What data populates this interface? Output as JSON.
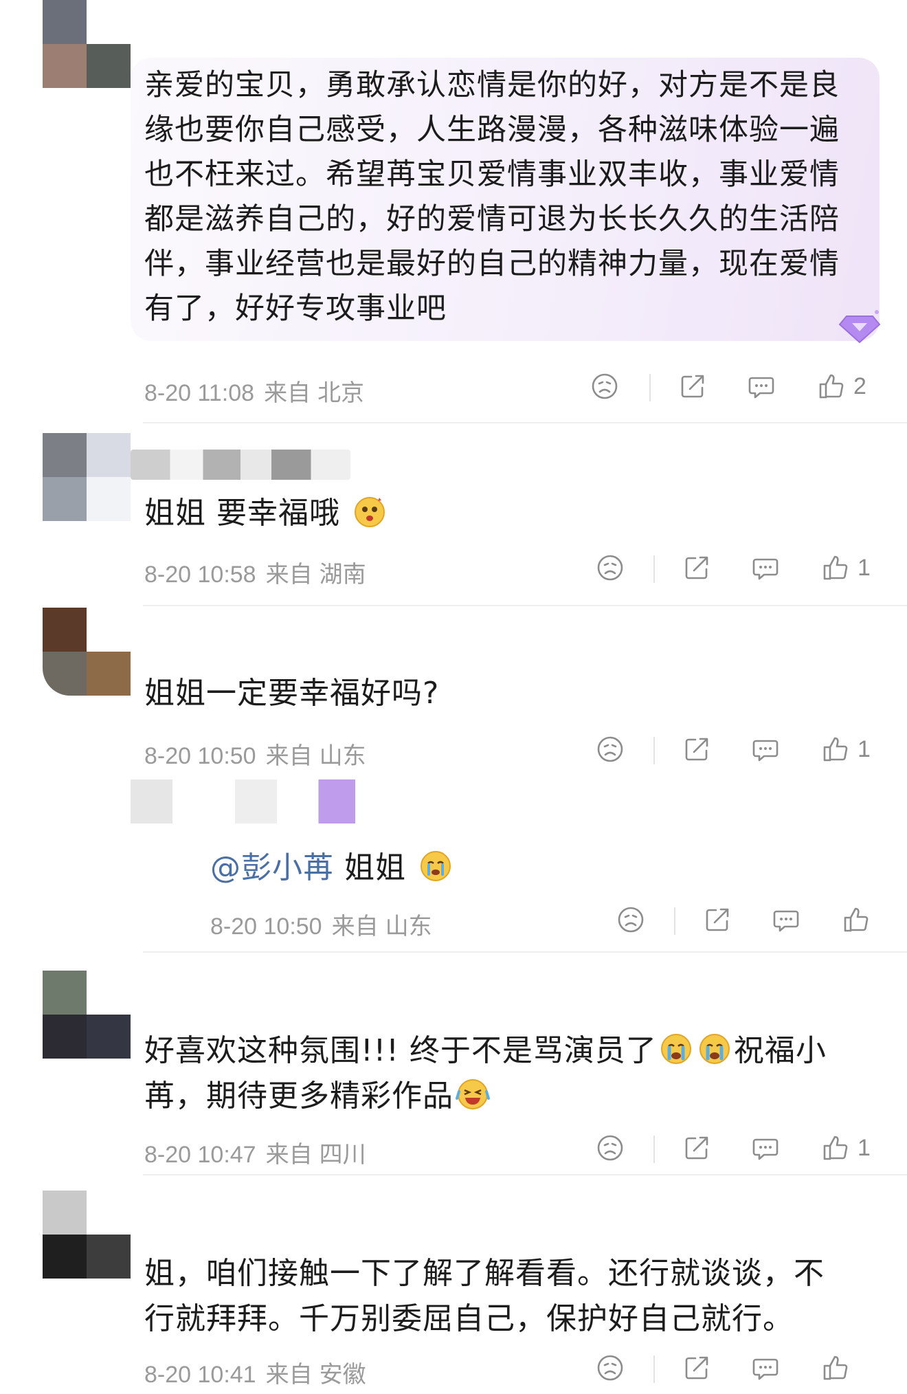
{
  "comments": [
    {
      "text": "亲爱的宝贝，勇敢承认恋情是你的好，对方是不是良缘也要你自己感受，人生路漫漫，各种滋味体验一遍也不枉来过。希望苒宝贝爱情事业双丰收，事业爱情都是滋养自己的，好的爱情可退为长长久久的生活陪伴，事业经营也是最好的自己的精神力量，现在爱情有了，好好专攻事业吧",
      "date": "8-20 11:08",
      "source_label": "来自",
      "location": "北京",
      "likes": "2"
    },
    {
      "text": "姐姐 要幸福哦",
      "date": "8-20 10:58",
      "source_label": "来自",
      "location": "湖南",
      "likes": "1"
    },
    {
      "text": "姐姐一定要幸福好吗?",
      "date": "8-20 10:50",
      "source_label": "来自",
      "location": "山东",
      "likes": "1",
      "reply": {
        "mention": "@彭小苒",
        "text": "姐姐",
        "date": "8-20 10:50",
        "source_label": "来自",
        "location": "山东"
      }
    },
    {
      "text_part1": "好喜欢这种氛围!!! 终于不是骂演员了",
      "text_part2": "祝福小苒，期待更多精彩作品",
      "date": "8-20 10:47",
      "source_label": "来自",
      "location": "四川",
      "likes": "1"
    },
    {
      "text": "姐，咱们接触一下了解了解看看。还行就谈谈，不行就拜拜。千万别委屈自己，保护好自己就行。",
      "date": "8-20 10:41",
      "source_label": "来自",
      "location": "安徽"
    }
  ],
  "icons": {
    "dislike": "frown-face-icon",
    "share": "share-icon",
    "comment": "comment-icon",
    "like": "thumbs-up-icon",
    "badge": "diamond-badge-icon"
  },
  "colors": {
    "meta_text": "#9a9a9a",
    "mention": "#4a6fa5",
    "bubble": "#f3ecfa"
  }
}
